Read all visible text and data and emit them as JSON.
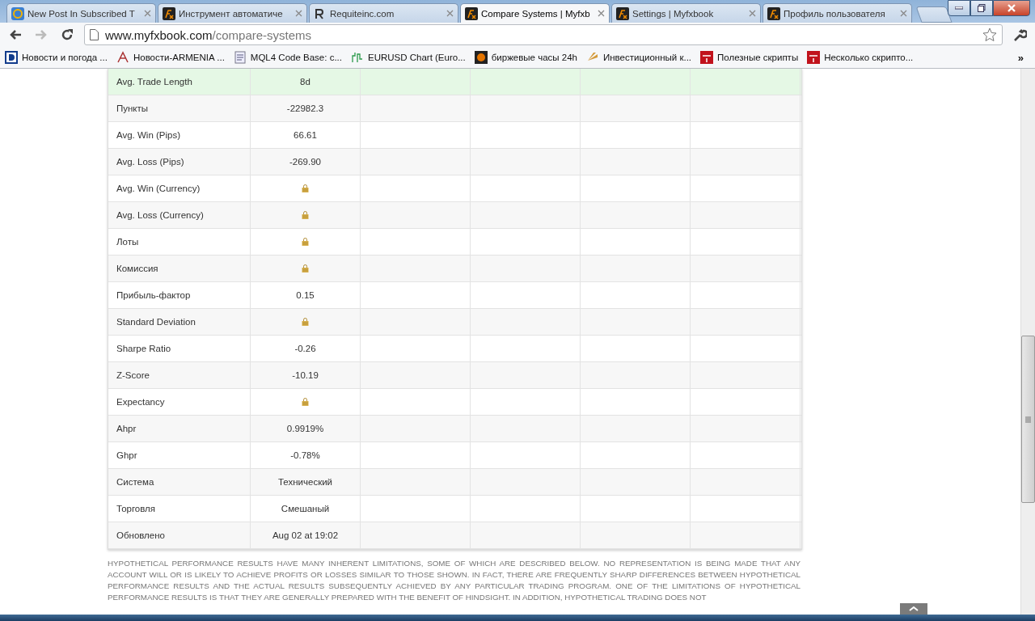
{
  "tabs": [
    {
      "title": "New Post In Subscribed T",
      "kind": "mail",
      "selected": false
    },
    {
      "title": "Инструмент автоматиче",
      "kind": "fx",
      "selected": false
    },
    {
      "title": "Requiteinc.com",
      "kind": "r",
      "selected": false
    },
    {
      "title": "Compare Systems | Myfxb",
      "kind": "fx",
      "selected": true
    },
    {
      "title": "Settings | Myfxbook",
      "kind": "fx",
      "selected": false
    },
    {
      "title": "Профиль пользователя",
      "kind": "fx",
      "selected": false
    }
  ],
  "address": {
    "host": "www.myfxbook.com",
    "path": "/compare-systems"
  },
  "bookmarks": [
    {
      "label": "Новости и погода ...",
      "kind": "d"
    },
    {
      "label": "Новости-ARMENIA ...",
      "kind": "a"
    },
    {
      "label": "MQL4 Code Base: c...",
      "kind": "doc"
    },
    {
      "label": "EURUSD Chart (Euro...",
      "kind": "chart"
    },
    {
      "label": "биржевые часы 24h",
      "kind": "clock"
    },
    {
      "label": "Инвестиционный к...",
      "kind": "fan"
    },
    {
      "label": "Полезные скрипты",
      "kind": "mt"
    },
    {
      "label": "Несколько скрипто...",
      "kind": "mt"
    }
  ],
  "bookmarks_more": "»",
  "table": {
    "rows": [
      {
        "label": "Avg. Trade Length",
        "value": "8d",
        "kind": "text",
        "highlighted": true
      },
      {
        "label": "Пункты",
        "value": "-22982.3",
        "kind": "text",
        "highlighted": false
      },
      {
        "label": "Avg. Win (Pips)",
        "value": "66.61",
        "kind": "text",
        "highlighted": false
      },
      {
        "label": "Avg. Loss (Pips)",
        "value": "-269.90",
        "kind": "text",
        "highlighted": false
      },
      {
        "label": "Avg. Win (Currency)",
        "kind": "locked",
        "highlighted": false
      },
      {
        "label": "Avg. Loss (Currency)",
        "kind": "locked",
        "highlighted": false
      },
      {
        "label": "Лоты",
        "kind": "locked",
        "highlighted": false
      },
      {
        "label": "Комиссия",
        "kind": "locked",
        "highlighted": false
      },
      {
        "label": "Прибыль-фактор",
        "value": "0.15",
        "kind": "text",
        "highlighted": false
      },
      {
        "label": "Standard Deviation",
        "kind": "locked",
        "highlighted": false
      },
      {
        "label": "Sharpe Ratio",
        "value": "-0.26",
        "kind": "text",
        "highlighted": false
      },
      {
        "label": "Z-Score",
        "value": "-10.19",
        "kind": "text",
        "highlighted": false
      },
      {
        "label": "Expectancy",
        "kind": "locked",
        "highlighted": false
      },
      {
        "label": "Ahpr",
        "value": "0.9919%",
        "kind": "text",
        "highlighted": false
      },
      {
        "label": "Ghpr",
        "value": "-0.78%",
        "kind": "text",
        "highlighted": false
      },
      {
        "label": "Система",
        "value": "Технический",
        "kind": "text",
        "highlighted": false
      },
      {
        "label": "Торговля",
        "value": "Смешаный",
        "kind": "text",
        "highlighted": false
      },
      {
        "label": "Обновлено",
        "value": "Aug 02 at 19:02",
        "kind": "text",
        "highlighted": false
      }
    ]
  },
  "disclaimer": "HYPOTHETICAL PERFORMANCE RESULTS HAVE MANY INHERENT LIMITATIONS, SOME OF WHICH ARE DESCRIBED BELOW. NO REPRESENTATION IS BEING MADE THAT ANY ACCOUNT WILL OR IS LIKELY TO ACHIEVE PROFITS OR LOSSES SIMILAR TO THOSE SHOWN. IN FACT, THERE ARE FREQUENTLY SHARP DIFFERENCES BETWEEN HYPOTHETICAL PERFORMANCE RESULTS AND THE ACTUAL RESULTS SUBSEQUENTLY ACHIEVED BY ANY PARTICULAR TRADING PROGRAM. ONE OF THE LIMITATIONS OF HYPOTHETICAL PERFORMANCE RESULTS IS THAT THEY ARE GENERALLY PREPARED WITH THE BENEFIT OF HINDSIGHT. IN ADDITION, HYPOTHETICAL TRADING DOES NOT"
}
